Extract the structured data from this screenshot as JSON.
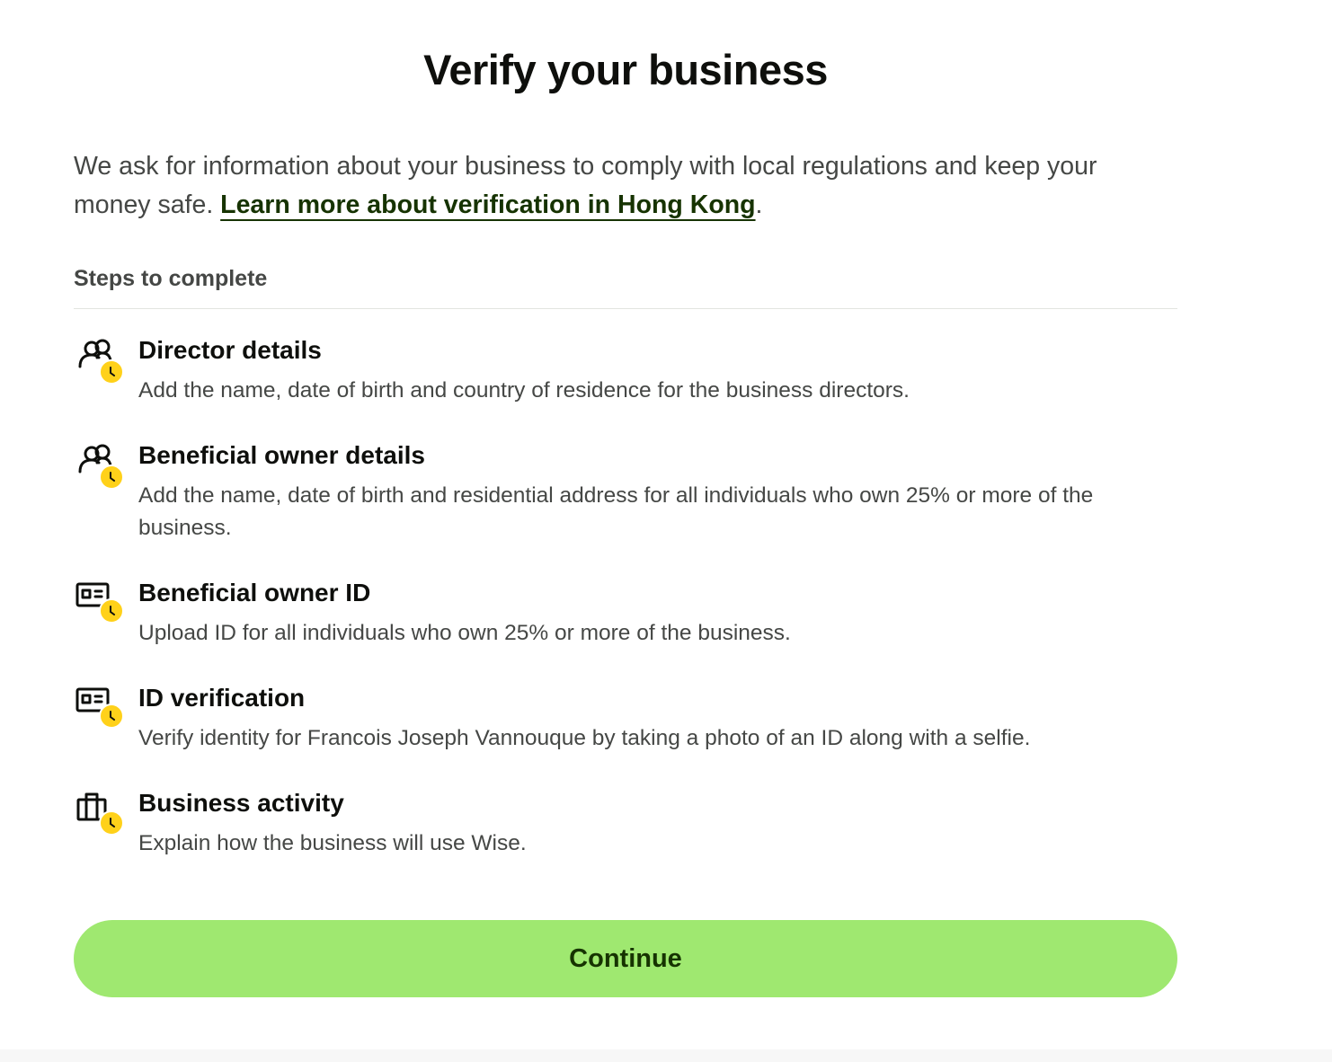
{
  "header": {
    "title": "Verify your business"
  },
  "intro": {
    "text": "We ask for information about your business to comply with local regulations and keep your money safe. ",
    "link_label": "Learn more about verification in Hong Kong",
    "trailing": "."
  },
  "steps_section": {
    "label": "Steps to complete",
    "steps": [
      {
        "icon": "people-icon",
        "status": "pending-clock-badge",
        "title": "Director details",
        "description": "Add the name, date of birth and country of residence for the business directors."
      },
      {
        "icon": "people-icon",
        "status": "pending-clock-badge",
        "title": "Beneficial owner details",
        "description": "Add the name, date of birth and residential address for all individuals who own 25% or more of the business."
      },
      {
        "icon": "id-card-icon",
        "status": "pending-clock-badge",
        "title": "Beneficial owner ID",
        "description": "Upload ID for all individuals who own 25% or more of the business."
      },
      {
        "icon": "id-card-icon",
        "status": "pending-clock-badge",
        "title": "ID verification",
        "description": "Verify identity for Francois Joseph Vannouque by taking a photo of an ID along with a selfie."
      },
      {
        "icon": "briefcase-icon",
        "status": "pending-clock-badge",
        "title": "Business activity",
        "description": "Explain how the business will use Wise."
      }
    ]
  },
  "actions": {
    "continue_label": "Continue"
  },
  "colors": {
    "primary_button": "#9fe870",
    "primary_button_text": "#163300",
    "link": "#163300",
    "pending_badge": "#ffd11a",
    "heading": "#0e0f0c",
    "body_text": "#454745"
  }
}
